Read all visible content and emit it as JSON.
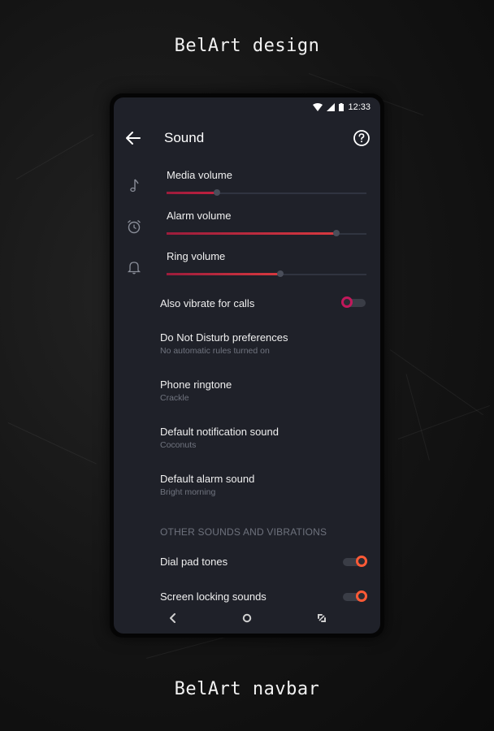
{
  "captions": {
    "top": "BelArt design",
    "bottom": "BelArt navbar"
  },
  "status_bar": {
    "time": "12:33",
    "icons": [
      "wifi-icon",
      "signal-icon",
      "battery-icon"
    ]
  },
  "app_bar": {
    "title": "Sound",
    "back_icon": "arrow-left-icon",
    "help_icon": "help-circle-icon"
  },
  "side_icons": [
    "music-note-icon",
    "alarm-clock-icon",
    "bell-icon"
  ],
  "volumes": [
    {
      "label": "Media volume",
      "level": 0.25,
      "color": "#c2203f"
    },
    {
      "label": "Alarm volume",
      "level": 0.85,
      "color": "#d8393f"
    },
    {
      "label": "Ring volume",
      "level": 0.57,
      "color": "#d8393f"
    }
  ],
  "vibrate": {
    "label": "Also vibrate for calls",
    "on": false,
    "accent": "#c2185b"
  },
  "settings": [
    {
      "primary": "Do Not Disturb preferences",
      "secondary": "No automatic rules turned on"
    },
    {
      "primary": "Phone ringtone",
      "secondary": "Crackle"
    },
    {
      "primary": "Default notification sound",
      "secondary": "Coconuts"
    },
    {
      "primary": "Default alarm sound",
      "secondary": "Bright morning"
    }
  ],
  "section_header": "OTHER SOUNDS AND VIBRATIONS",
  "toggles": [
    {
      "label": "Dial pad tones",
      "on": true,
      "accent": "#ff5a36"
    },
    {
      "label": "Screen locking sounds",
      "on": true,
      "accent": "#ff5a36"
    }
  ],
  "nav_bar": {
    "buttons": [
      "nav-back-icon",
      "nav-home-icon",
      "nav-recents-icon"
    ]
  }
}
